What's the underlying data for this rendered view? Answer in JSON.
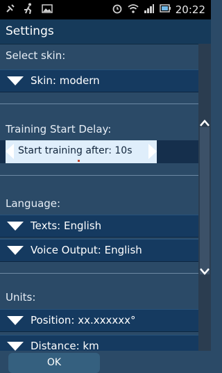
{
  "status_bar": {
    "time": "20:22",
    "left_icons": [
      "satellite-icon",
      "runner-icon",
      "image-icon"
    ],
    "right_icons": [
      "alarm-icon",
      "wifi-icon",
      "signal-icon",
      "battery-icon"
    ]
  },
  "title": "Settings",
  "sections": {
    "skin": {
      "label": "Select skin:",
      "item": "Skin: modern"
    },
    "delay": {
      "label": "Training Start Delay:",
      "value_text": "Start training after: 10s"
    },
    "language": {
      "label": "Language:",
      "texts": "Texts: English",
      "voice": "Voice Output: English"
    },
    "units": {
      "label": "Units:",
      "position": "Position: xx.xxxxxx°",
      "distance": "Distance: km"
    }
  },
  "ok_button": "OK",
  "colors": {
    "background": "#2b4a67",
    "title_bar": "#163a5a",
    "row_background": "#153a60",
    "delay_highlight": "#dfeefb",
    "ok_button": "#35607f"
  }
}
